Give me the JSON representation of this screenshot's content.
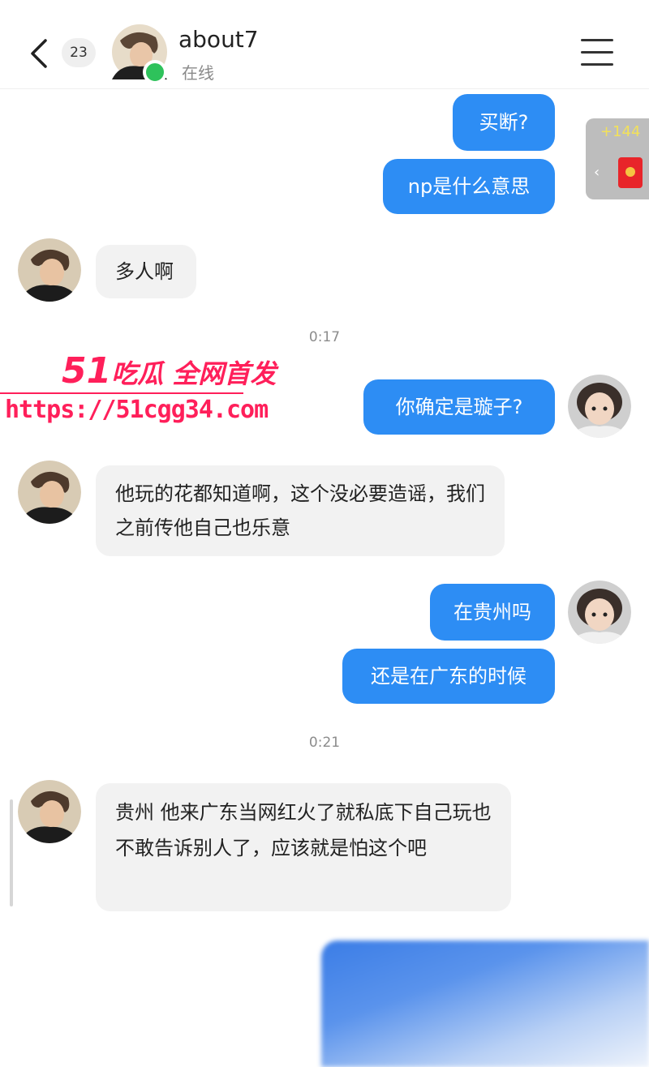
{
  "header": {
    "unread_count": "23",
    "contact_name": "about7",
    "status": "在线"
  },
  "side_tab": {
    "count": "+144",
    "arrow": "‹"
  },
  "messages": [
    {
      "dir": "out",
      "text": "买断?"
    },
    {
      "dir": "out",
      "text": "np是什么意思"
    },
    {
      "dir": "in",
      "text": "多人啊"
    },
    {
      "dir": "out",
      "text": "你确定是璇子?"
    },
    {
      "dir": "in",
      "text": "他玩的花都知道啊，这个没必要造谣，我们之前传他自己也乐意"
    },
    {
      "dir": "out",
      "text": "在贵州吗"
    },
    {
      "dir": "out",
      "text": "还是在广东的时候"
    },
    {
      "dir": "in",
      "text": "贵州 他来广东当网红火了就私底下自己玩也不敢告诉别人了，应该就是怕这个吧"
    }
  ],
  "timestamps": [
    "0:17",
    "0:21"
  ],
  "watermark": {
    "brand_num": "51",
    "brand_text": "吃瓜 全网首发",
    "url": "https://51cgg34.com"
  },
  "colors": {
    "outgoing_bubble": "#2d8df4",
    "incoming_bubble": "#f2f2f2",
    "online": "#2ec25b",
    "watermark": "#ff1f5a"
  }
}
